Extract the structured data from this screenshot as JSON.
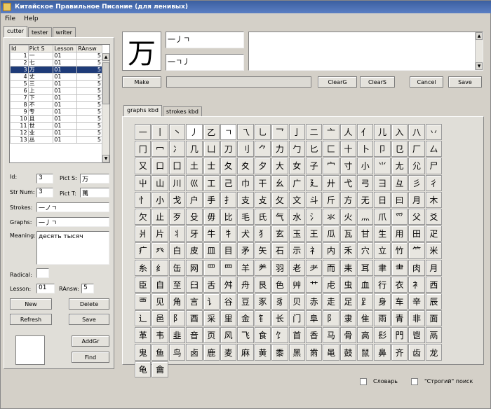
{
  "window": {
    "title": "Китайское Правильное Писание (для ленивых)"
  },
  "menu": [
    "File",
    "Help"
  ],
  "left_tabs": [
    "cutter",
    "tester",
    "writer"
  ],
  "table": {
    "headers": [
      "Id",
      "Pict S",
      "Lesson",
      "RAnsw"
    ],
    "rows": [
      [
        "1",
        "一",
        "01",
        "5"
      ],
      [
        "2",
        "七",
        "01",
        "5"
      ],
      [
        "3",
        "万",
        "01",
        "5"
      ],
      [
        "4",
        "丈",
        "01",
        "5"
      ],
      [
        "5",
        "三",
        "01",
        "5"
      ],
      [
        "6",
        "上",
        "01",
        "5"
      ],
      [
        "7",
        "下",
        "01",
        "5"
      ],
      [
        "8",
        "不",
        "01",
        "5"
      ],
      [
        "9",
        "专",
        "01",
        "5"
      ],
      [
        "10",
        "且",
        "01",
        "5"
      ],
      [
        "11",
        "世",
        "01",
        "5"
      ],
      [
        "12",
        "业",
        "01",
        "5"
      ],
      [
        "13",
        "丛",
        "01",
        "5"
      ]
    ],
    "selected_index": 2
  },
  "form": {
    "id_label": "Id:",
    "id_value": "3",
    "pict_s_label": "Pict S:",
    "pict_s_value": "万",
    "str_num_label": "Str Num:",
    "str_num_value": "3",
    "pict_t_label": "Pict T:",
    "pict_t_value": "萬",
    "strokes_label": "Strokes:",
    "strokes_value": "一ノㄱ",
    "graphs_label": "Graphs:",
    "graphs_value": "一丿ㄱ",
    "meaning_label": "Meaning:",
    "meaning_value": "десять тысяч",
    "radical_label": "Radical:",
    "radical_value": "",
    "lesson_label": "Lesson:",
    "lesson_value": "01",
    "ransw_label": "RAnsw:",
    "ransw_value": "5"
  },
  "left_buttons": {
    "new": "New",
    "delete": "Delete",
    "refresh": "Refresh",
    "save": "Save",
    "addgr": "AddGr",
    "find": "Find"
  },
  "preview": {
    "char": "万",
    "strokes_top": "一丿ㄱ",
    "strokes_bottom": "一ㄱ丿"
  },
  "action_buttons": {
    "make": "Make",
    "clearg": "ClearG",
    "clears": "ClearS",
    "cancel": "Cancel",
    "save": "Save"
  },
  "kbd_tabs": [
    "graphs kbd",
    "strokes kbd"
  ],
  "keyboard": [
    "一",
    "丨",
    "丶",
    "丿",
    "乙",
    "ㄱ",
    "乁",
    "乚",
    "乛",
    "亅",
    "二",
    "亠",
    "人",
    "亻",
    "儿",
    "入",
    "八",
    "丷",
    "冂",
    "冖",
    "冫",
    "几",
    "凵",
    "刀",
    "刂",
    "⺈",
    "力",
    "勹",
    "匕",
    "匚",
    "十",
    "卜",
    "卩",
    "㔾",
    "厂",
    "厶",
    "又",
    "口",
    "囗",
    "土",
    "士",
    "夂",
    "夊",
    "夕",
    "大",
    "女",
    "子",
    "宀",
    "寸",
    "小",
    "⺌",
    "尢",
    "尣",
    "尸",
    "屮",
    "山",
    "川",
    "巛",
    "工",
    "己",
    "巾",
    "干",
    "幺",
    "广",
    "廴",
    "廾",
    "弋",
    "弓",
    "彐",
    "彑",
    "彡",
    "彳",
    "忄",
    "小",
    "戈",
    "户",
    "手",
    "扌",
    "支",
    "攴",
    "攵",
    "文",
    "斗",
    "斤",
    "方",
    "无",
    "日",
    "曰",
    "月",
    "木",
    "欠",
    "止",
    "歹",
    "殳",
    "毋",
    "比",
    "毛",
    "氏",
    "气",
    "水",
    "氵",
    "氺",
    "火",
    "灬",
    "爪",
    "爫",
    "父",
    "爻",
    "爿",
    "片",
    "丬",
    "牙",
    "牛",
    "牜",
    "犬",
    "犭",
    "玄",
    "玉",
    "王",
    "瓜",
    "瓦",
    "甘",
    "生",
    "用",
    "田",
    "疋",
    "疒",
    "癶",
    "白",
    "皮",
    "皿",
    "目",
    "矛",
    "矢",
    "石",
    "示",
    "礻",
    "内",
    "禾",
    "穴",
    "立",
    "竹",
    "⺮",
    "米",
    "糸",
    "纟",
    "缶",
    "网",
    "罒",
    "⺲",
    "羊",
    "⺶",
    "羽",
    "老",
    "耂",
    "而",
    "耒",
    "耳",
    "聿",
    "⺻",
    "肉",
    "月",
    "臣",
    "自",
    "至",
    "臼",
    "舌",
    "舛",
    "舟",
    "艮",
    "色",
    "艸",
    "艹",
    "虍",
    "虫",
    "血",
    "行",
    "衣",
    "衤",
    "西",
    "覀",
    "见",
    "角",
    "言",
    "讠",
    "谷",
    "豆",
    "豕",
    "豸",
    "贝",
    "赤",
    "走",
    "足",
    "⻊",
    "身",
    "车",
    "辛",
    "辰",
    "辶",
    "邑",
    "阝",
    "酉",
    "采",
    "里",
    "金",
    "钅",
    "长",
    "门",
    "阜",
    "阝",
    "隶",
    "隹",
    "雨",
    "青",
    "非",
    "面",
    "革",
    "韦",
    "韭",
    "音",
    "页",
    "风",
    "飞",
    "食",
    "饣",
    "首",
    "香",
    "马",
    "骨",
    "高",
    "髟",
    "門",
    "鬯",
    "鬲",
    "鬼",
    "鱼",
    "鸟",
    "卤",
    "鹿",
    "麦",
    "麻",
    "黄",
    "黍",
    "黑",
    "黹",
    "黾",
    "鼓",
    "鼠",
    "鼻",
    "齐",
    "齿",
    "龙",
    "龟",
    "龠"
  ],
  "keyboard_selected": [
    3,
    5
  ],
  "footer": {
    "dictionary": "Словарь",
    "strict_search": "\"Строгий\" поиск"
  }
}
